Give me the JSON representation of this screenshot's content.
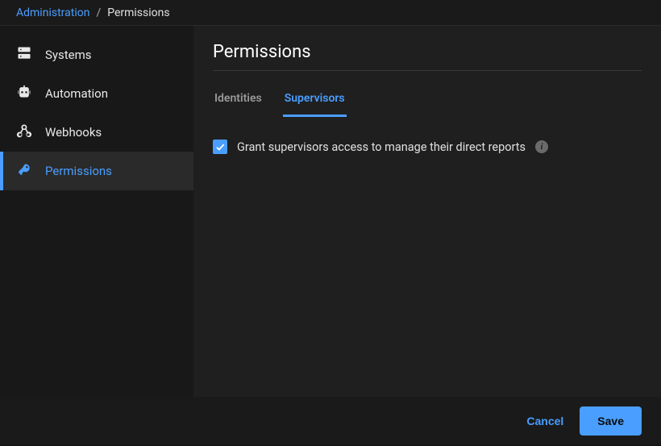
{
  "breadcrumb": {
    "parent": "Administration",
    "separator": "/",
    "current": "Permissions"
  },
  "sidebar": {
    "items": [
      {
        "label": "Systems"
      },
      {
        "label": "Automation"
      },
      {
        "label": "Webhooks"
      },
      {
        "label": "Permissions"
      }
    ]
  },
  "main": {
    "title": "Permissions",
    "tabs": [
      {
        "label": "Identities"
      },
      {
        "label": "Supervisors"
      }
    ],
    "checkbox_label": "Grant supervisors access to manage their direct reports"
  },
  "footer": {
    "cancel": "Cancel",
    "save": "Save"
  }
}
